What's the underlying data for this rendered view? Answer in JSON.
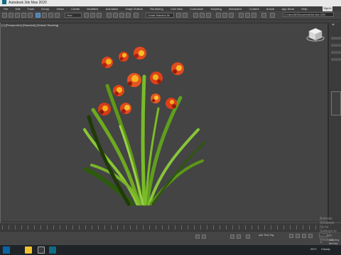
{
  "window": {
    "title": "Autodesk 3ds Max 2020",
    "signin_label": "Sign In"
  },
  "menu": [
    "File",
    "Edit",
    "Tools",
    "Group",
    "Views",
    "Create",
    "Modifiers",
    "Animation",
    "Graph Editors",
    "Rendering",
    "Civil View",
    "Customize",
    "Scripting",
    "Interactive",
    "Content",
    "Arnold",
    "App Store",
    "Help"
  ],
  "toolbar": {
    "view_dropdown": "View",
    "selection_set_dropdown": "Create Selection Se",
    "path_value": "C:\\Users\\MH\\Documents\\3ds Max 2020"
  },
  "viewport": {
    "label": "[+] [Perspective] [Standard] [Default Shading]",
    "watermark_1": "Activate Windows",
    "watermark_2": "Go to Settings to activate Windows."
  },
  "status": {
    "auto_key_label": "Auto Key",
    "set_key_label": "Set Key",
    "key_filters_label": "Key Filters...",
    "time_tag_label": "Add Time Tag",
    "frame_value": "0"
  },
  "taskbar": {
    "temperature": "25°C",
    "weather": "Cloudy"
  },
  "colors": {
    "viewport_bg": "#444444",
    "accent_blue": "#4c7fb1",
    "flower_orange": "#e0471c",
    "flower_yellow": "#f3b21a",
    "leaf_green": "#73b521",
    "leaf_dark": "#2d5b0c"
  }
}
